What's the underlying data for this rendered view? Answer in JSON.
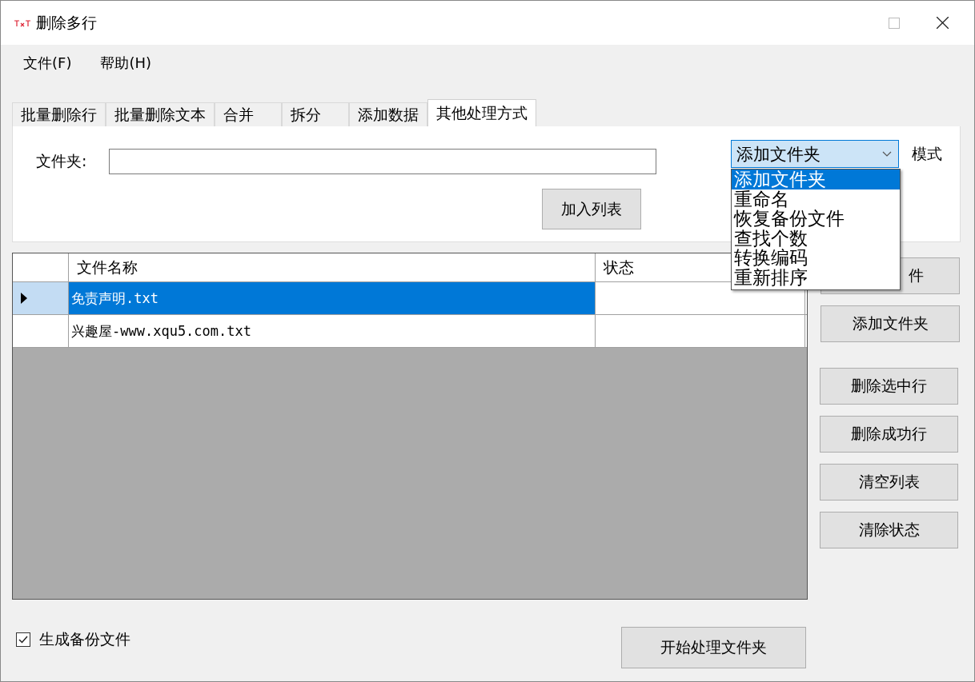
{
  "window": {
    "title": "删除多行"
  },
  "menu": [
    "文件(F)",
    "帮助(H)"
  ],
  "tabs": [
    {
      "label": "批量删除行",
      "selected": false
    },
    {
      "label": "批量删除文本",
      "selected": false
    },
    {
      "label": "合并",
      "selected": false
    },
    {
      "label": "拆分",
      "selected": false
    },
    {
      "label": "添加数据",
      "selected": false
    },
    {
      "label": "其他处理方式",
      "selected": true
    }
  ],
  "folder_label": "文件夹:",
  "add_to_list_button": "加入列表",
  "mode": {
    "label": "模式",
    "value": "添加文件夹",
    "expanded": true,
    "options": [
      {
        "label": "添加文件夹",
        "selected": true
      },
      {
        "label": "重命名",
        "selected": false
      },
      {
        "label": "恢复备份文件",
        "selected": false
      },
      {
        "label": "查找个数",
        "selected": false
      },
      {
        "label": "转换编码",
        "selected": false
      },
      {
        "label": "重新排序",
        "selected": false
      }
    ]
  },
  "table": {
    "columns": [
      "文件名称",
      "状态"
    ],
    "rows": [
      {
        "name": "免责声明.txt",
        "selected": true
      },
      {
        "name": "兴趣屋-www.xqu5.com.txt",
        "selected": false
      }
    ]
  },
  "side_buttons": [
    "件",
    "添加文件夹",
    "删除选中行",
    "删除成功行",
    "清空列表",
    "清除状态"
  ],
  "backup": {
    "label": "生成备份文件",
    "checked": true
  },
  "start_button": "开始处理文件夹"
}
